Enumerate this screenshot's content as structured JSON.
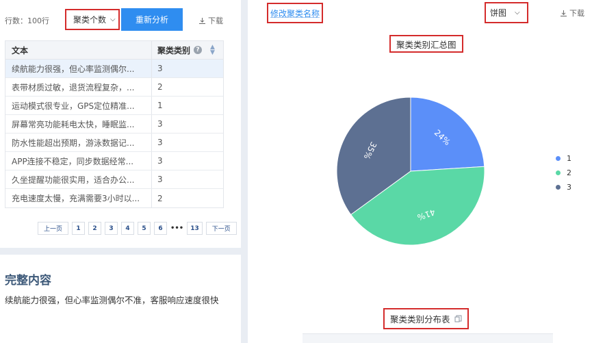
{
  "left": {
    "row_count": "行数：100行",
    "cluster_select": "聚类个数",
    "reanalyze_button": "重新分析",
    "download": "下载",
    "table": {
      "headers": [
        "文本",
        "聚类类别"
      ],
      "rows": [
        {
          "text": "续航能力很强，但心率监测偶尔...",
          "cat": "3"
        },
        {
          "text": "表带材质过敏，退货流程复杂，...",
          "cat": "2"
        },
        {
          "text": "运动模式很专业，GPS定位精准...",
          "cat": "1"
        },
        {
          "text": "屏幕常亮功能耗电太快，睡眠监...",
          "cat": "3"
        },
        {
          "text": "防水性能超出预期，游泳数据记...",
          "cat": "3"
        },
        {
          "text": "APP连接不稳定，同步数据经常...",
          "cat": "3"
        },
        {
          "text": "久坐提醒功能很实用，适合办公...",
          "cat": "3"
        },
        {
          "text": "充电速度太慢，充满需要3小时以...",
          "cat": "2"
        }
      ]
    },
    "pager": {
      "prev": "上一页",
      "pages": [
        "1",
        "2",
        "3",
        "4",
        "5",
        "6"
      ],
      "ellipsis": "•••",
      "last": "13",
      "next": "下一页"
    },
    "full_content_title": "完整内容",
    "full_content_text": "续航能力很强，但心率监测偶尔不准，客服响应速度很快"
  },
  "right": {
    "rename_button": "修改聚类名称",
    "chart_type_select": "饼图",
    "download": "下载",
    "chart_title": "聚类类别汇总图",
    "distribution_title": "聚类类别分布表"
  },
  "icons": {
    "download": "download-icon",
    "help": "help-circle-icon",
    "sort": "sort-icon",
    "chevron": "chevron-down-icon",
    "copy": "copy-icon"
  },
  "chart_data": {
    "type": "pie",
    "title": "聚类类别汇总图",
    "categories": [
      "1",
      "2",
      "3"
    ],
    "values": [
      24,
      41,
      35
    ],
    "labels": [
      "24%",
      "41%",
      "35%"
    ],
    "colors": [
      "#5b8ff9",
      "#5ad8a6",
      "#5d7092"
    ],
    "legend": "right"
  }
}
